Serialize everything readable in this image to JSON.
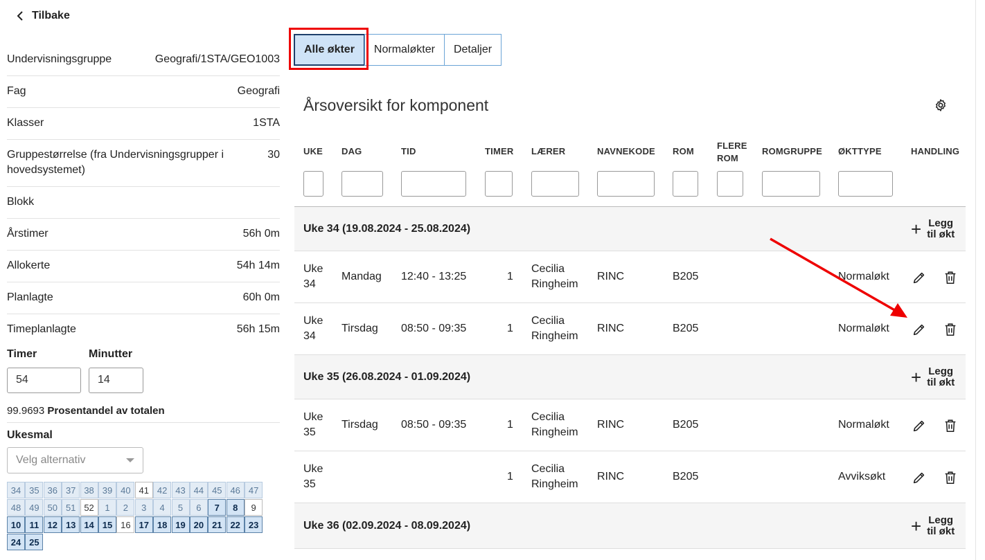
{
  "back": {
    "label": "Tilbake"
  },
  "info": [
    {
      "label": "Undervisningsgruppe",
      "value": "Geografi/1STA/GEO1003"
    },
    {
      "label": "Fag",
      "value": "Geografi"
    },
    {
      "label": "Klasser",
      "value": "1STA"
    },
    {
      "label": "Gruppestørrelse (fra Undervisningsgrupper i hovedsystemet)",
      "value": "30"
    },
    {
      "label": "Blokk",
      "value": ""
    },
    {
      "label": "Årstimer",
      "value": "56h 0m"
    },
    {
      "label": "Allokerte",
      "value": "54h 14m"
    },
    {
      "label": "Planlagte",
      "value": "60h 0m"
    },
    {
      "label": "Timeplanlagte",
      "value": "56h 15m"
    }
  ],
  "timer": {
    "label": "Timer",
    "value": "54"
  },
  "minutter": {
    "label": "Minutter",
    "value": "14"
  },
  "percent": {
    "value": "99.9693",
    "label": "Prosentandel av totalen"
  },
  "ukesmal": {
    "label": "Ukesmal",
    "placeholder": "Velg alternativ"
  },
  "weeks": [
    {
      "n": "34",
      "s": "past"
    },
    {
      "n": "35",
      "s": "past"
    },
    {
      "n": "36",
      "s": "past"
    },
    {
      "n": "37",
      "s": "past"
    },
    {
      "n": "38",
      "s": "past"
    },
    {
      "n": "39",
      "s": "past"
    },
    {
      "n": "40",
      "s": "past"
    },
    {
      "n": "41",
      "s": "cur"
    },
    {
      "n": "42",
      "s": "past"
    },
    {
      "n": "43",
      "s": "past"
    },
    {
      "n": "44",
      "s": "past"
    },
    {
      "n": "45",
      "s": "past"
    },
    {
      "n": "46",
      "s": "past"
    },
    {
      "n": "47",
      "s": "past"
    },
    {
      "n": "48",
      "s": "past"
    },
    {
      "n": "49",
      "s": "past"
    },
    {
      "n": "50",
      "s": "past"
    },
    {
      "n": "51",
      "s": "past"
    },
    {
      "n": "52",
      "s": "cur"
    },
    {
      "n": "1",
      "s": "past"
    },
    {
      "n": "2",
      "s": "past"
    },
    {
      "n": "3",
      "s": "past"
    },
    {
      "n": "4",
      "s": "past"
    },
    {
      "n": "5",
      "s": "past"
    },
    {
      "n": "6",
      "s": "past"
    },
    {
      "n": "7",
      "s": "fut"
    },
    {
      "n": "8",
      "s": "fut"
    },
    {
      "n": "9",
      "s": "cur"
    },
    {
      "n": "10",
      "s": "fut"
    },
    {
      "n": "11",
      "s": "fut"
    },
    {
      "n": "12",
      "s": "fut"
    },
    {
      "n": "13",
      "s": "fut"
    },
    {
      "n": "14",
      "s": "fut"
    },
    {
      "n": "15",
      "s": "fut"
    },
    {
      "n": "16",
      "s": "cur"
    },
    {
      "n": "17",
      "s": "fut"
    },
    {
      "n": "18",
      "s": "fut"
    },
    {
      "n": "19",
      "s": "fut"
    },
    {
      "n": "20",
      "s": "fut"
    },
    {
      "n": "21",
      "s": "fut"
    },
    {
      "n": "22",
      "s": "fut"
    },
    {
      "n": "23",
      "s": "fut"
    },
    {
      "n": "24",
      "s": "fut"
    },
    {
      "n": "25",
      "s": "fut"
    }
  ],
  "tabs": [
    {
      "label": "Alle økter",
      "active": true
    },
    {
      "label": "Normaløkter",
      "active": false
    },
    {
      "label": "Detaljer",
      "active": false
    }
  ],
  "section_title": "Årsoversikt for komponent",
  "columns": {
    "uke": "UKE",
    "dag": "DAG",
    "tid": "TID",
    "timer": "TIMER",
    "laerer": "LÆRER",
    "navnekode": "NAVNEKODE",
    "rom": "ROM",
    "flere_rom_1": "FLERE",
    "flere_rom_2": "ROM",
    "romgruppe": "ROMGRUPPE",
    "okttype": "ØKTTYPE",
    "handling": "HANDLING"
  },
  "add_label_1": "Legg",
  "add_label_2": "til økt",
  "groups": [
    {
      "title": "Uke 34 (19.08.2024 - 25.08.2024)"
    },
    {
      "title": "Uke 35 (26.08.2024 - 01.09.2024)"
    },
    {
      "title": "Uke 36 (02.09.2024 - 08.09.2024)"
    }
  ],
  "rows": [
    {
      "uke1": "Uke",
      "uke2": "34",
      "dag": "Mandag",
      "tid": "12:40 - 13:25",
      "timer": "1",
      "laerer1": "Cecilia",
      "laerer2": "Ringheim",
      "kode": "RINC",
      "rom": "B205",
      "type": "Normaløkt"
    },
    {
      "uke1": "Uke",
      "uke2": "34",
      "dag": "Tirsdag",
      "tid": "08:50 - 09:35",
      "timer": "1",
      "laerer1": "Cecilia",
      "laerer2": "Ringheim",
      "kode": "RINC",
      "rom": "B205",
      "type": "Normaløkt"
    },
    {
      "uke1": "Uke",
      "uke2": "35",
      "dag": "Tirsdag",
      "tid": "08:50 - 09:35",
      "timer": "1",
      "laerer1": "Cecilia",
      "laerer2": "Ringheim",
      "kode": "RINC",
      "rom": "B205",
      "type": "Normaløkt"
    },
    {
      "uke1": "Uke",
      "uke2": "35",
      "dag": "",
      "tid": "",
      "timer": "1",
      "laerer1": "Cecilia",
      "laerer2": "Ringheim",
      "kode": "RINC",
      "rom": "B205",
      "type": "Avviksøkt"
    }
  ],
  "colors": {
    "accent": "#1e3f6b",
    "tab_active_bg": "#cfe3f7",
    "tab_border": "#6aa4d6",
    "highlight": "#ee0000"
  }
}
